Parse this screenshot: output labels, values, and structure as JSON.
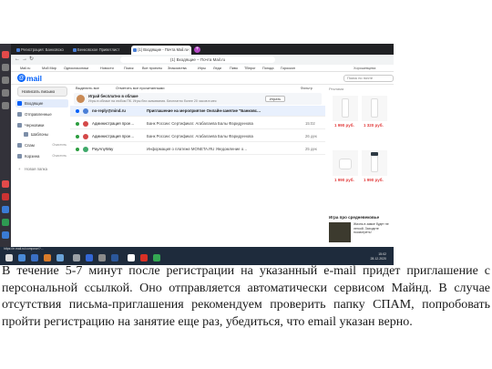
{
  "browser": {
    "tabs": [
      {
        "label": "Регистрация: Банковско"
      },
      {
        "label": "Бенковское Приветлист"
      },
      {
        "label": "(1) Входящие - Почта Mail.ru"
      }
    ],
    "new_tab": "+",
    "url": "(1) Входящие – Почта Mail.ru",
    "nav_back": "←",
    "nav_forward": "→",
    "nav_reload": "↻"
  },
  "bookmarks": [
    "Mail.ru",
    "Мой Мир",
    "Одноклассники",
    "Новости",
    "Поиск",
    "Все проекты",
    "Знакомства",
    "Игры",
    "Леди",
    "Пиво",
    "ТВпрог",
    "Погода",
    "Гороскоп"
  ],
  "mail": {
    "logo_at": "@",
    "logo_text": "mail",
    "search_placeholder": "Поиск по почте",
    "user_label": "Хорошевцева",
    "write_button": "Написать письмо",
    "folders": [
      {
        "name": "Входящие",
        "count": "",
        "color": "#005ff9"
      },
      {
        "name": "Отправленные",
        "count": "",
        "color": "#7c8ea8"
      },
      {
        "name": "Черновики",
        "count": "",
        "color": "#7c8ea8"
      },
      {
        "name": "Шаблоны",
        "count": "",
        "color": "#7c8ea8"
      },
      {
        "name": "Спам",
        "count": "Очистить",
        "color": "#7c8ea8"
      },
      {
        "name": "Корзина",
        "count": "Очистить",
        "color": "#7c8ea8"
      }
    ],
    "new_folder": "Новая папка",
    "toolbar": {
      "select_all": "Выделить все",
      "mark_read": "Отметить все прочитанными",
      "filter": "Фильтр"
    },
    "promo": {
      "title": "Играй бесплатно в облаке",
      "text": "Игры в облаке на любом ПК. Игры без скачивания. Бесплатно более 20 часов в мес",
      "button": "Играть"
    },
    "messages": [
      {
        "sender": "no-reply@mind.ru",
        "subject": "Приглашение на мероприятие Онлайн-занятие \"Банковс…",
        "time": "",
        "highlight": true,
        "dot": "#005ff9",
        "avatar": "#4a7fd6"
      },
      {
        "sender": "Администрация прое…",
        "subject": "Банк России: Сертификат. Агабалаева Балы Фаридуннова",
        "time": "15:02",
        "highlight": false,
        "dot": "#2c9d3f",
        "avatar": "#d44848"
      },
      {
        "sender": "Администрация прое…",
        "subject": "Банк России: Сертификат. Агабалаева Балы Фаридуннова",
        "time": "26 дек",
        "highlight": false,
        "dot": "#2c9d3f",
        "avatar": "#d44848"
      },
      {
        "sender": "PayAnyWay",
        "subject": "Информация о платеже   MONETA.RU Уведомление о…",
        "time": "25 дек",
        "highlight": false,
        "dot": "#2c9d3f",
        "avatar": "#3fa96a"
      }
    ]
  },
  "ads": {
    "label": "Реклама",
    "prices": [
      "1 990 руб.",
      "1 320 руб.",
      "1 990 руб.",
      "1 990 руб."
    ],
    "game_head": "Игра про средневековье",
    "game_text": "Жизнь в замке будет не легкой. Заходите посмотреть!"
  },
  "taskbar": {
    "tooltip": "https://e.mail.ru/compose/?...",
    "clock_time": "15:02",
    "clock_date": "28.12.2020"
  },
  "caption": "В течение 5-7 минут после регистрации на указанный e-mail придет приглашение с персональной ссылкой. Оно отправляется автоматически сервисом Майнд. В случае отсутствия письма-приглашения рекомендуем проверить папку СПАМ, попробовать пройти регистрацию на занятие еще раз, убедиться, что email указан верно."
}
